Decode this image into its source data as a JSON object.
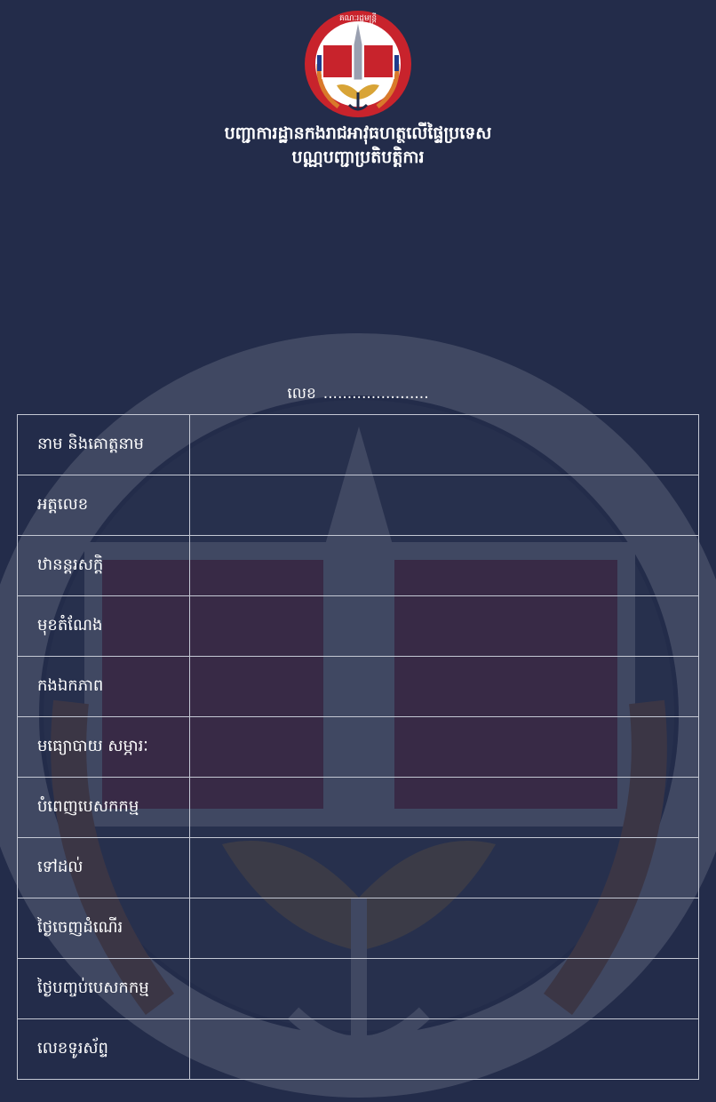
{
  "header": {
    "logo": {
      "ring_text": "គណៈរដ្ឋមន្ត្រី",
      "emblem_text": "អ ហ",
      "colors": {
        "ring_red": "#c8232c",
        "band_blue": "#1f3c8c",
        "laurel_orange": "#d9792b",
        "wings_gold": "#d8a437"
      }
    },
    "line1": "បញ្ជាការដ្ឋានកងរាជអាវុធហត្ថលើផ្ទៃប្រទេស",
    "line2": "បណ្ណបញ្ជាប្រតិបត្តិការ"
  },
  "doc_number": {
    "label": "លេខ",
    "dots": "......................"
  },
  "form": {
    "rows": [
      {
        "label": "នាម និងគោត្តនាម",
        "value": ""
      },
      {
        "label": "អត្តលេខ",
        "value": ""
      },
      {
        "label": "ឋានន្តរសក្តិ",
        "value": ""
      },
      {
        "label": "មុខតំណែង",
        "value": ""
      },
      {
        "label": "កងឯកភាព",
        "value": ""
      },
      {
        "label": "មធ្យោបាយ សម្ភារៈ",
        "value": ""
      },
      {
        "label": "បំពេញបេសកកម្ម",
        "value": ""
      },
      {
        "label": "ទៅដល់",
        "value": ""
      },
      {
        "label": "ថ្ងៃចេញដំណើរ",
        "value": ""
      },
      {
        "label": "ថ្ងៃបញ្ចប់បេសកកម្ម",
        "value": ""
      },
      {
        "label": "លេខទូរស័ព្ទ",
        "value": ""
      }
    ]
  },
  "colors": {
    "background": "#232c4a",
    "table_border": "#c4c8d4",
    "text": "#ffffff"
  }
}
